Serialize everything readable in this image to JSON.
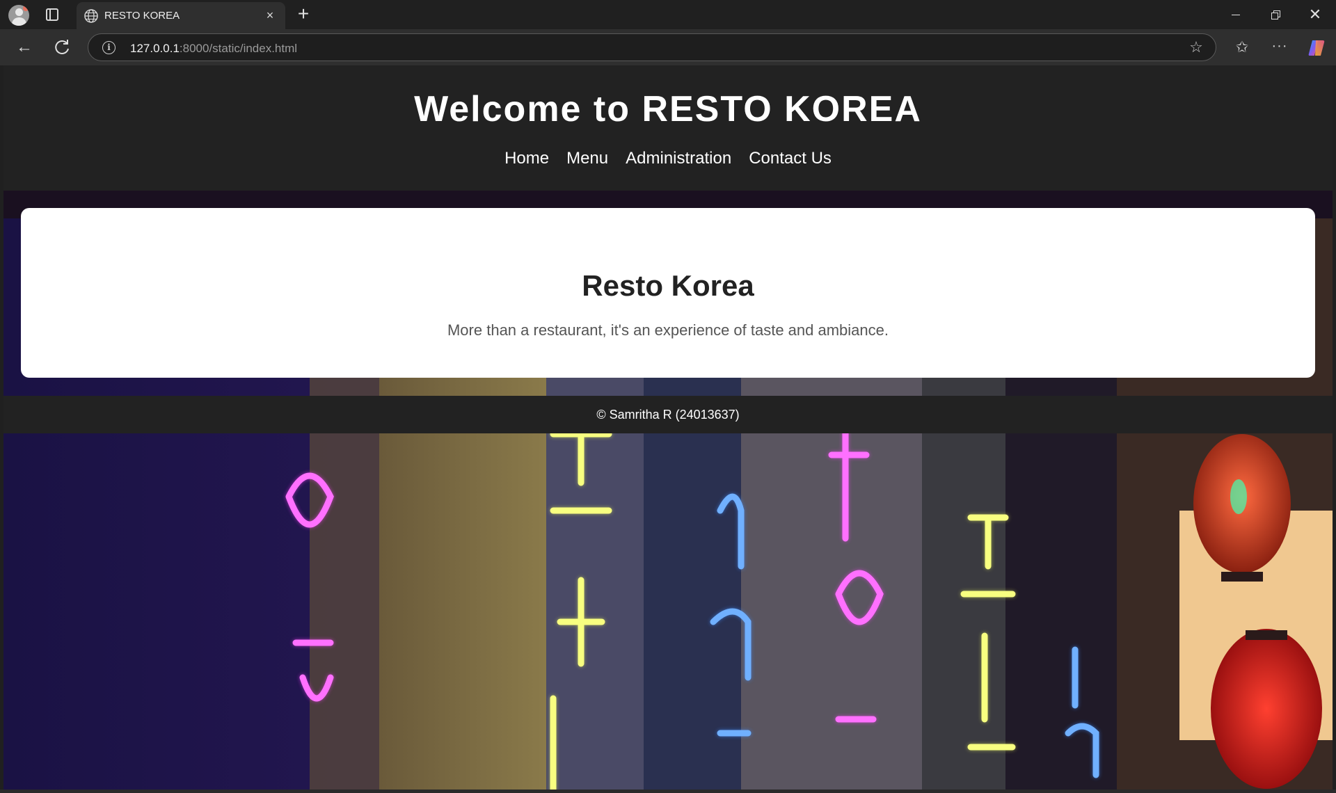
{
  "browser": {
    "tab_title": "RESTO KOREA",
    "url_host": "127.0.0.1",
    "url_rest": ":8000/static/index.html",
    "tab_close_glyph": "×",
    "new_tab_glyph": "+",
    "close_window_glyph": "✕",
    "back_glyph": "←",
    "info_glyph": "i",
    "star_glyph": "☆",
    "favorites_glyph": "✩",
    "more_glyph": "···"
  },
  "header": {
    "title": "Welcome to RESTO KOREA",
    "nav": [
      "Home",
      "Menu",
      "Administration",
      "Contact Us"
    ]
  },
  "hero": {
    "title": "Resto Korea",
    "subtitle": "More than a restaurant, it's an experience of taste and ambiance."
  },
  "footer": {
    "text": "© Samritha R (24013637)"
  },
  "background": {
    "description_icon": "neon-korean-signs-image",
    "colors": {
      "neon_pink": "#ff3cff",
      "neon_yellow": "#f4ff5a",
      "neon_blue": "#3c8cff",
      "lantern_red": "#e02020",
      "dark": "#140a22"
    }
  }
}
